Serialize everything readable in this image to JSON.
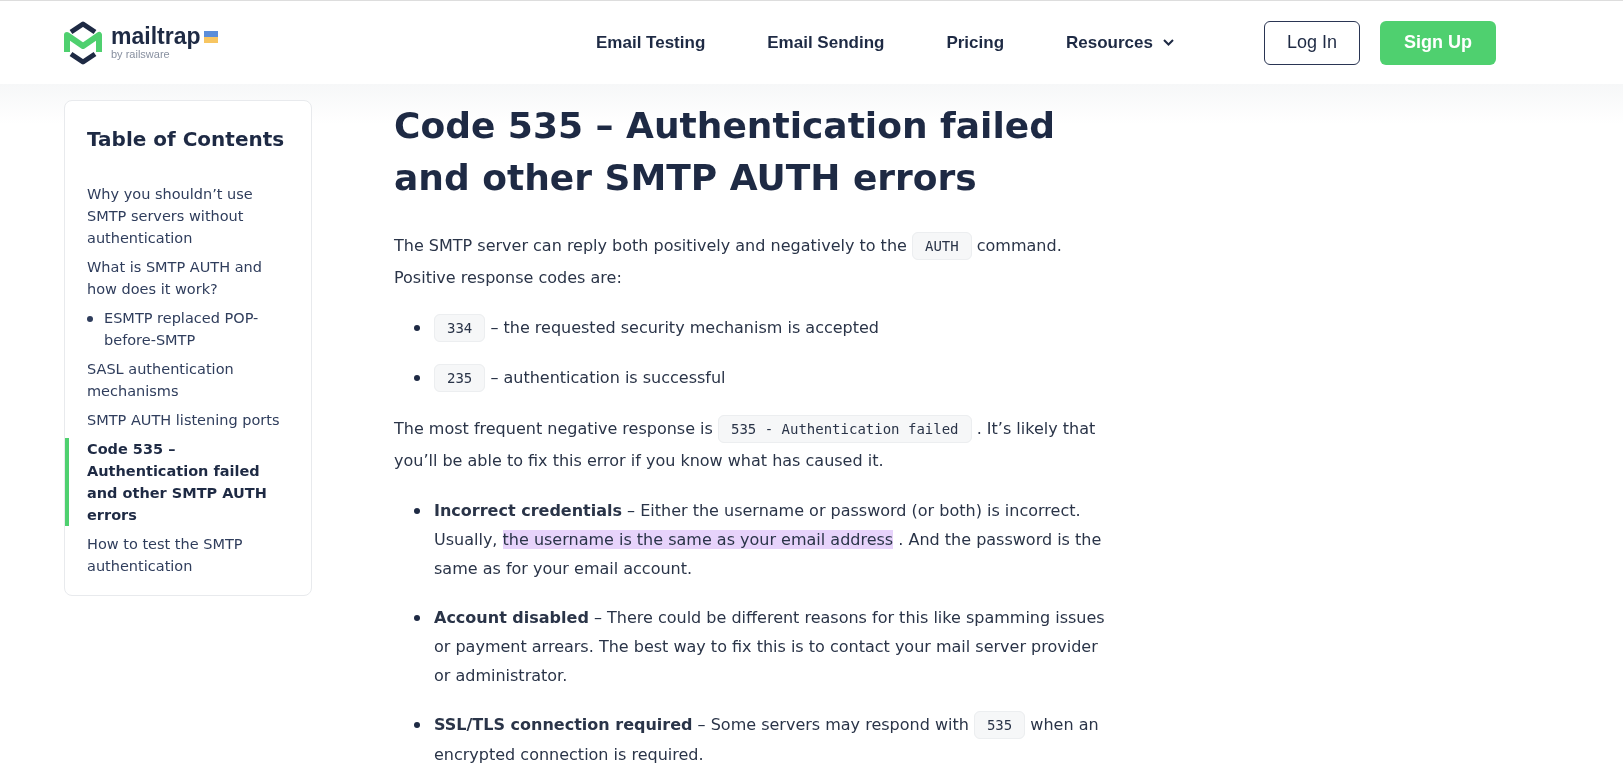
{
  "header": {
    "logo": {
      "name": "mailtrap",
      "tagline": "by railsware"
    },
    "nav": [
      {
        "label": "Email Testing",
        "dropdown": false
      },
      {
        "label": "Email Sending",
        "dropdown": false
      },
      {
        "label": "Pricing",
        "dropdown": false
      },
      {
        "label": "Resources",
        "dropdown": true
      }
    ],
    "buttons": [
      {
        "label": "Log In",
        "kind": "outline"
      },
      {
        "label": "Sign Up",
        "kind": "primary"
      }
    ]
  },
  "toc": {
    "title": "Table of Contents",
    "items": [
      {
        "label": "Why you shouldn’t use SMTP servers without authentication",
        "selected": false
      },
      {
        "label": "What is SMTP AUTH and how does it work?",
        "selected": false,
        "children": [
          {
            "label": "ESMTP replaced POP-before-SMTP",
            "selected": false
          }
        ]
      },
      {
        "label": "SASL authentication mechanisms",
        "selected": false
      },
      {
        "label": "SMTP AUTH listening ports",
        "selected": false
      },
      {
        "label": "Code 535 – Authentication failed and other SMTP AUTH errors",
        "selected": true
      },
      {
        "label": "How to test the SMTP authentication",
        "selected": false
      }
    ]
  },
  "article": {
    "title": "Code 535 – Authentication failed and other SMTP AUTH errors",
    "blocks": [
      {
        "kind": "paragraph",
        "segments": [
          {
            "kind": "text",
            "text": "The SMTP server can reply both positively and negatively to the"
          },
          {
            "kind": "code",
            "text": "AUTH"
          },
          {
            "kind": "text",
            "text": "command. Positive response codes are:"
          }
        ]
      },
      {
        "kind": "list",
        "items": [
          [
            {
              "kind": "code",
              "text": "334"
            },
            {
              "kind": "text",
              "text": "– the requested security mechanism is accepted"
            }
          ],
          [
            {
              "kind": "code",
              "text": "235"
            },
            {
              "kind": "text",
              "text": "– authentication is successful"
            }
          ]
        ]
      },
      {
        "kind": "paragraph",
        "segments": [
          {
            "kind": "text",
            "text": "The most frequent negative response is"
          },
          {
            "kind": "code",
            "text": "535 - Authentication failed"
          },
          {
            "kind": "text",
            "text": ". It’s likely that you’ll be able to fix this error if you know what has caused it."
          }
        ]
      },
      {
        "kind": "list",
        "items": [
          [
            {
              "kind": "text",
              "text": "**Incorrect credentials** – Either the username or password (or both) is incorrect. Usually,"
            },
            {
              "kind": "highlight",
              "text": "the username is the same as your email address"
            },
            {
              "kind": "text",
              "text": ". And the password is the same as for your email account."
            }
          ],
          [
            {
              "kind": "text",
              "text": "**Account disabled** – There could be different reasons for this like spamming issues or payment arrears. The best way to fix this is to contact your mail server provider or administrator."
            }
          ],
          [
            {
              "kind": "text",
              "text": "**SSL/TLS connection required** – Some servers may respond with"
            },
            {
              "kind": "code",
              "text": "535"
            },
            {
              "kind": "text",
              "text": "when an encrypted connection is required."
            }
          ]
        ]
      }
    ]
  }
}
